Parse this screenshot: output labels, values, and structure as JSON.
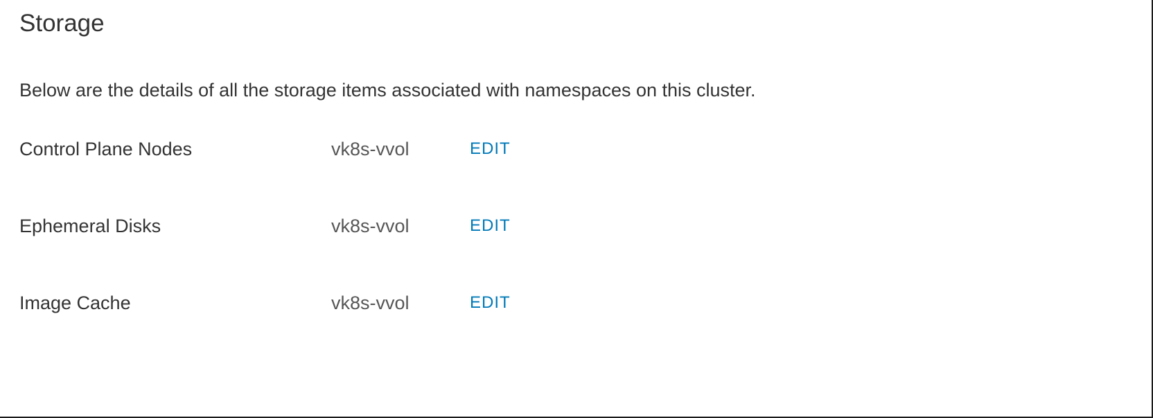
{
  "section": {
    "title": "Storage",
    "description": "Below are the details of all the storage items associated with namespaces on this cluster."
  },
  "storage_items": [
    {
      "label": "Control Plane Nodes",
      "value": "vk8s-vvol",
      "action": "EDIT"
    },
    {
      "label": "Ephemeral Disks",
      "value": "vk8s-vvol",
      "action": "EDIT"
    },
    {
      "label": "Image Cache",
      "value": "vk8s-vvol",
      "action": "EDIT"
    }
  ]
}
